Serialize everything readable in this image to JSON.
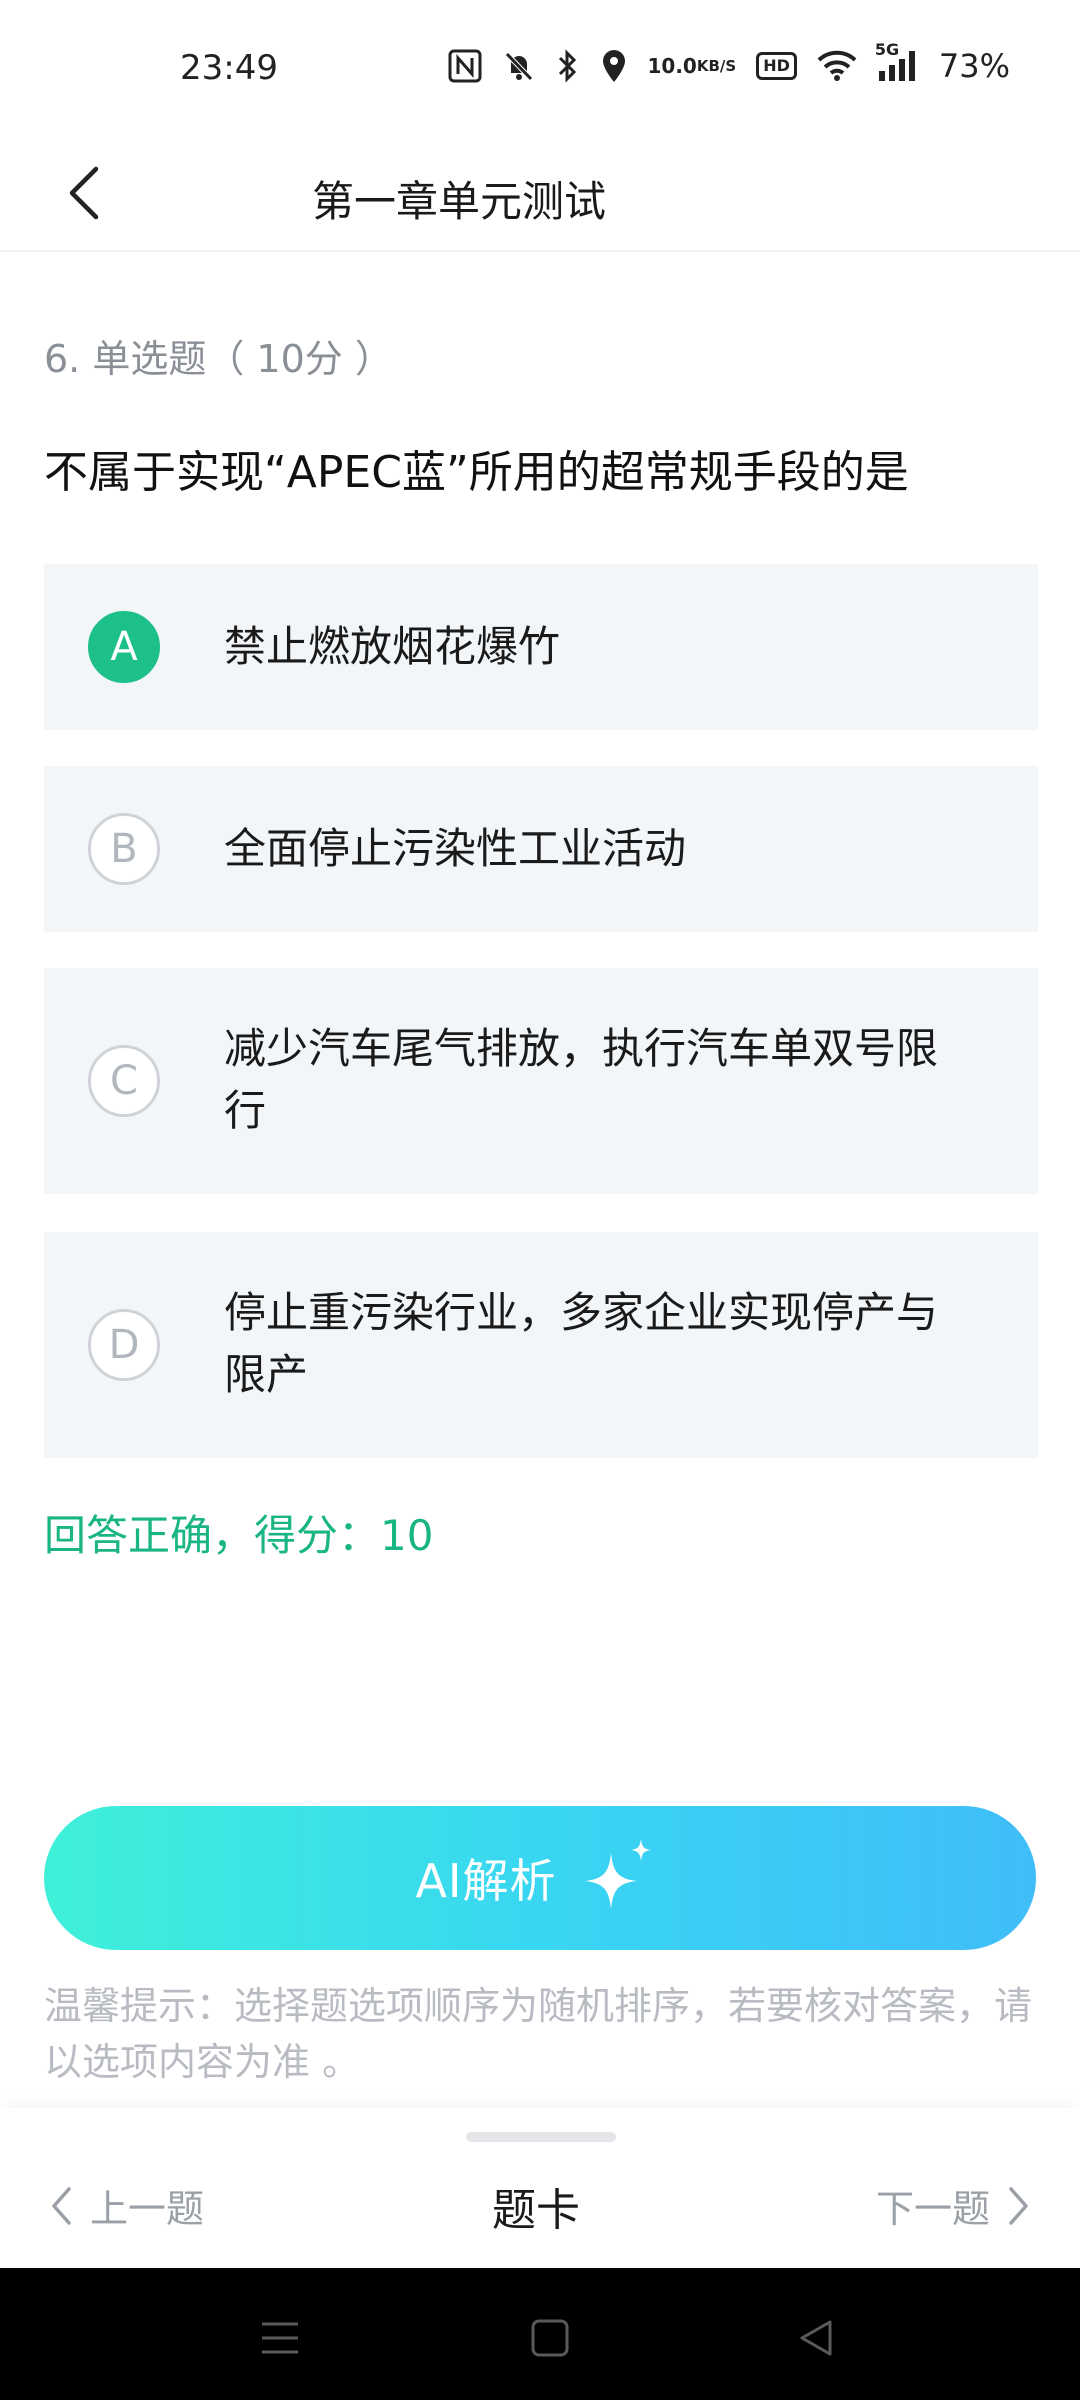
{
  "status_bar": {
    "time": "23:49",
    "net_speed_top": "10.0",
    "net_speed_unit": "KB/S",
    "hd_label": "HD",
    "network_label": "5G",
    "battery": "73%",
    "icons": [
      "nfc-icon",
      "mute-icon",
      "bluetooth-icon",
      "location-icon",
      "wifi-icon",
      "signal-icon"
    ]
  },
  "header": {
    "title": "第一章单元测试"
  },
  "question": {
    "meta": "6. 单选题（ 10分 ）",
    "text": "不属于实现“APEC蓝”所用的超常规手段的是",
    "options": [
      {
        "letter": "A",
        "text": "禁止燃放烟花爆竹",
        "selected": true
      },
      {
        "letter": "B",
        "text": "全面停止污染性工业活动",
        "selected": false
      },
      {
        "letter": "C",
        "text": "减少汽车尾气排放，执行汽车单双号限行",
        "selected": false
      },
      {
        "letter": "D",
        "text": "停止重污染行业，多家企业实现停产与限产",
        "selected": false
      }
    ],
    "result": "回答正确，得分：10"
  },
  "ai_button": {
    "label": "AI解析"
  },
  "tip": "温馨提示：选择题选项顺序为随机排序，若要核对答案，请以选项内容为准 。",
  "bottom_nav": {
    "prev": "上一题",
    "card": "题卡",
    "next": "下一题"
  },
  "colors": {
    "accent_green": "#1ec08a",
    "result_green": "#1ab584",
    "ai_gradient_start": "#3ef0d8",
    "ai_gradient_end": "#3fbdf8",
    "option_bg": "#f3f6f9"
  }
}
